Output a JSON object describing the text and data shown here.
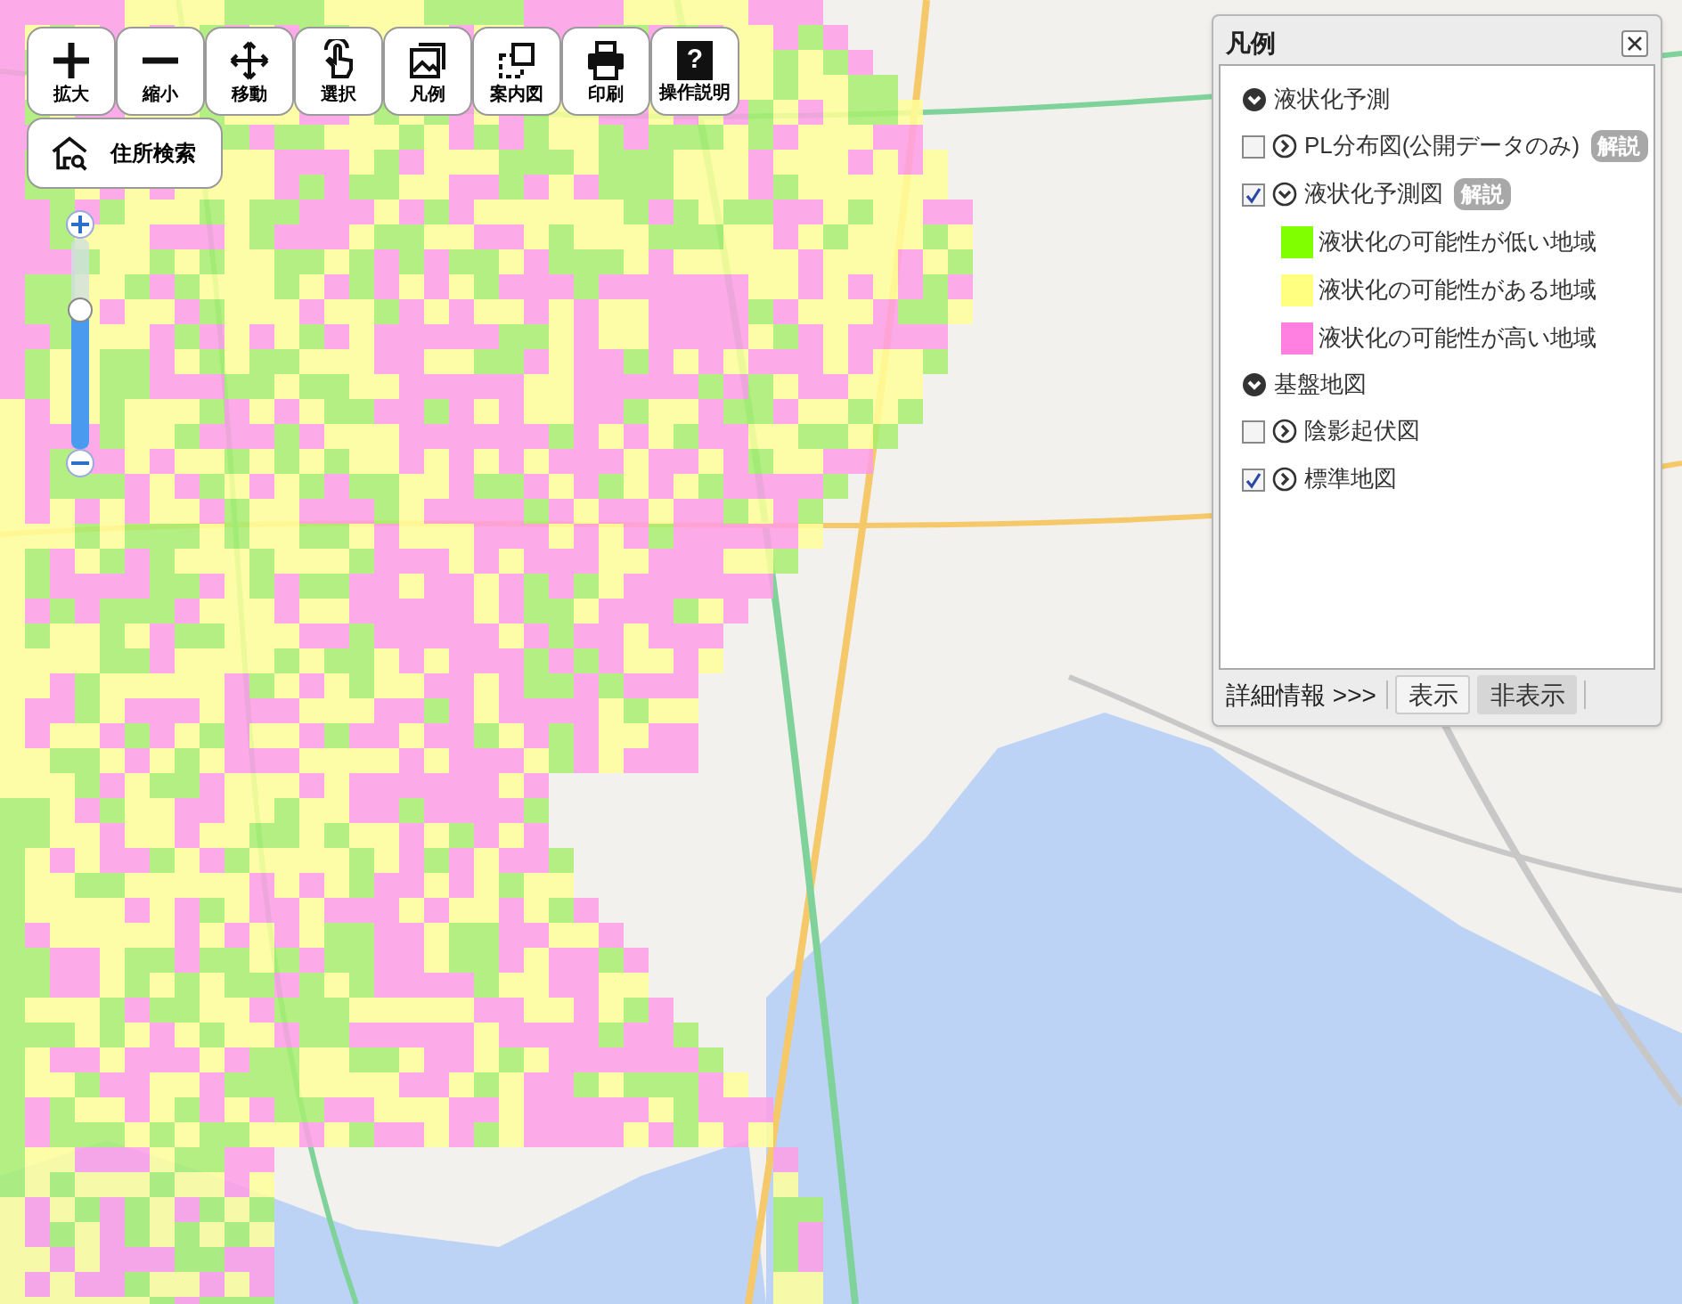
{
  "toolbar": {
    "buttons": [
      {
        "label": "拡大",
        "kind": "plus"
      },
      {
        "label": "縮小",
        "kind": "minus"
      },
      {
        "label": "移動",
        "kind": "move"
      },
      {
        "label": "選択",
        "kind": "hand"
      },
      {
        "label": "凡例",
        "kind": "legend"
      },
      {
        "label": "案内図",
        "kind": "guide"
      },
      {
        "label": "印刷",
        "kind": "print"
      },
      {
        "label": "操作説明",
        "kind": "help",
        "icon_text": "?"
      }
    ]
  },
  "address_search": {
    "label": "住所検索"
  },
  "zoom_slider": {
    "level": 0.66
  },
  "legend": {
    "title": "凡例",
    "sections": [
      {
        "label": "液状化予測",
        "expanded": true,
        "children": [
          {
            "label": "PL分布図(公開データのみ)",
            "checked": false,
            "expanded": false,
            "info_button": "解説"
          },
          {
            "label": "液状化予測図",
            "checked": true,
            "expanded": true,
            "info_button": "解説",
            "children": [
              {
                "label": "液状化の可能性が低い地域",
                "color": "#80ff00"
              },
              {
                "label": "液状化の可能性がある地域",
                "color": "#ffff80"
              },
              {
                "label": "液状化の可能性が高い地域",
                "color": "#ff80e0"
              }
            ]
          }
        ]
      },
      {
        "label": "基盤地図",
        "expanded": true,
        "children": [
          {
            "label": "陰影起伏図",
            "checked": false,
            "expanded": false
          },
          {
            "label": "標準地図",
            "checked": true,
            "expanded": false
          }
        ]
      }
    ],
    "footer": {
      "details_link": "詳細情報 >>>",
      "buttons": [
        {
          "label": "表示",
          "selected": false
        },
        {
          "label": "非表示",
          "selected": true
        }
      ]
    }
  }
}
